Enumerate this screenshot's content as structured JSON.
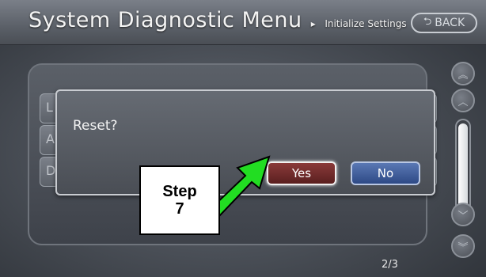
{
  "header": {
    "title": "System Diagnostic Menu",
    "breadcrumb_sep": "▸",
    "subtitle": "Initialize Settings",
    "back_label": "BACK",
    "back_icon": "back-arrow-icon"
  },
  "list": {
    "row_letters": [
      "L",
      "A",
      "D"
    ]
  },
  "dialog": {
    "message": "Reset?",
    "yes_label": "Yes",
    "no_label": "No"
  },
  "pager": {
    "page_indicator": "2/3"
  },
  "callout": {
    "line1": "Step",
    "line2": "7",
    "arrow_color": "#22dd22"
  },
  "colors": {
    "yes_button": "#7a3030",
    "no_button": "#3f5e9e",
    "accent_arrow": "#22dd22"
  }
}
